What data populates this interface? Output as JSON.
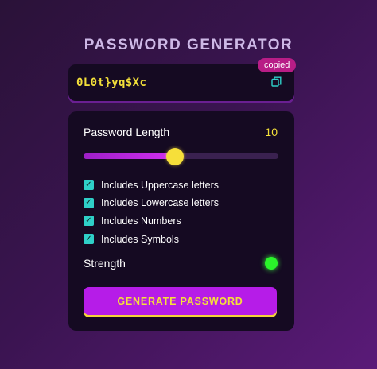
{
  "app": {
    "title": "PASSWORD GENERATOR"
  },
  "password_display": {
    "value": "0L0t}yq$Xc",
    "copy_icon": "copy-icon",
    "copied_badge": "copied"
  },
  "settings": {
    "length_label": "Password Length",
    "length_value": "10",
    "slider_level_percent": 47,
    "options": [
      {
        "label": "Includes Uppercase letters",
        "checked": true
      },
      {
        "label": "Includes Lowercase letters",
        "checked": true
      },
      {
        "label": "Includes Numbers",
        "checked": true
      },
      {
        "label": "Includes Symbols",
        "checked": true
      }
    ],
    "strength_label": "Strength",
    "strength_color": "#2af52a"
  },
  "actions": {
    "generate_label": "GENERATE PASSWORD"
  },
  "colors": {
    "accent": "#b61ce8",
    "highlight": "#f6df3a",
    "checkbox": "#2fd0c8",
    "badge": "#b81d86"
  }
}
